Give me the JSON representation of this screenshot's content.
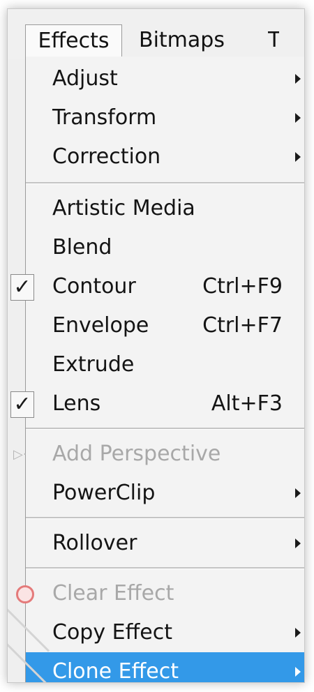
{
  "menubar": {
    "items": [
      {
        "label": "Effects",
        "active": true
      },
      {
        "label": "Bitmaps",
        "active": false
      },
      {
        "label": "T",
        "active": false
      }
    ]
  },
  "menu": {
    "items": [
      {
        "label": "Adjust",
        "submenu": true
      },
      {
        "label": "Transform",
        "submenu": true
      },
      {
        "label": "Correction",
        "submenu": true
      },
      {
        "label": "Artistic Media"
      },
      {
        "label": "Blend"
      },
      {
        "label": "Contour",
        "shortcut": "Ctrl+F9",
        "checked": true
      },
      {
        "label": "Envelope",
        "shortcut": "Ctrl+F7"
      },
      {
        "label": "Extrude"
      },
      {
        "label": "Lens",
        "shortcut": "Alt+F3",
        "checked": true
      },
      {
        "label": "Add Perspective",
        "disabled": true
      },
      {
        "label": "PowerClip",
        "submenu": true
      },
      {
        "label": "Rollover",
        "submenu": true
      },
      {
        "label": "Clear Effect",
        "disabled": true
      },
      {
        "label": "Copy Effect",
        "submenu": true
      },
      {
        "label": "Clone Effect",
        "submenu": true,
        "selected": true
      }
    ],
    "check_glyph": "✓",
    "icons": {
      "add_perspective": "perspective-icon",
      "clear_effect": "clear-effect-icon"
    },
    "colors": {
      "highlight": "#3399e8",
      "disabled_text": "#a8a8a8",
      "menu_bg": "#f3f3f3"
    }
  }
}
